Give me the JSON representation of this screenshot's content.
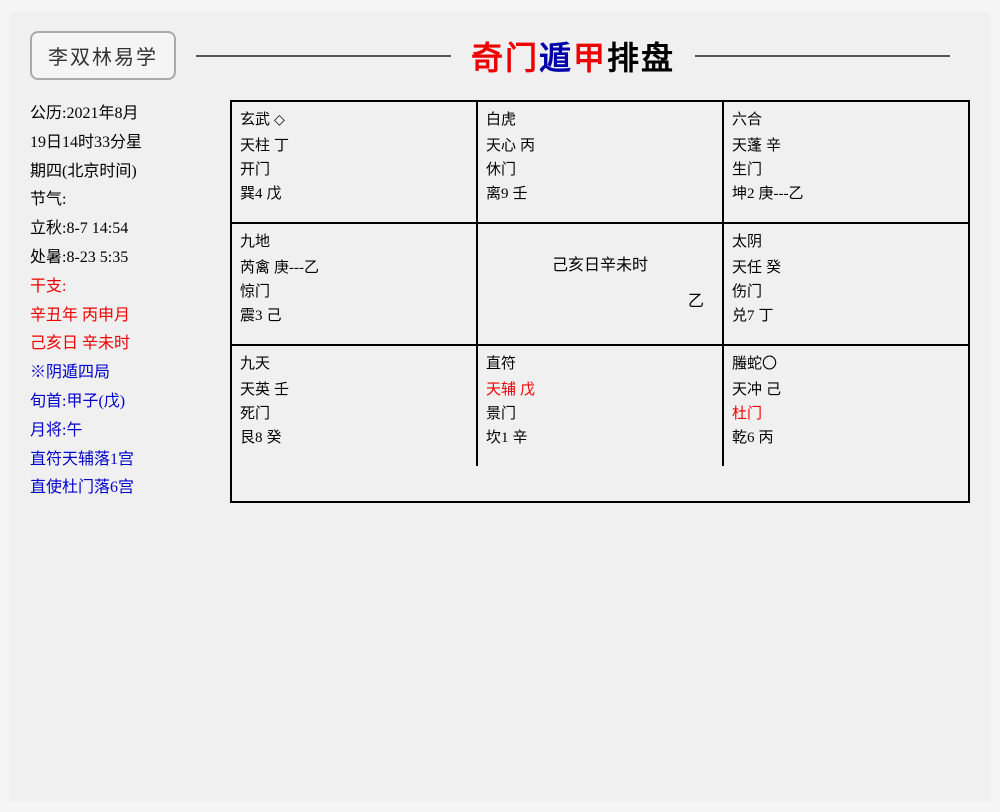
{
  "header": {
    "logo": "李双林易学",
    "title_part1": "奇门",
    "title_part2": "遁甲",
    "title_part3": "排盘"
  },
  "left_panel": {
    "line1": "公历:2021年8月",
    "line2": "19日14时33分星",
    "line3": "期四(北京时间)",
    "line4": "节气:",
    "line5": "立秋:8-7  14:54",
    "line6": "处暑:8-23  5:35",
    "line7": "干支:",
    "line8": "辛丑年 丙申月",
    "line9": "己亥日 辛未时",
    "line10": "※阴遁四局",
    "line11": "旬首:甲子(戊)",
    "line12": "月将:午",
    "line13": "直符天辅落1宫",
    "line14": "直使杜门落6宫"
  },
  "grid": {
    "row1": [
      {
        "shen": "玄武",
        "extra": "◇",
        "star": "天柱",
        "star_stem": "丁",
        "door": "开门",
        "palace": "巽4",
        "palace_stem": "戊"
      },
      {
        "shen": "白虎",
        "extra": "",
        "star": "天心",
        "star_stem": "丙",
        "door": "休门",
        "palace": "离9",
        "palace_stem": "壬"
      },
      {
        "shen": "六合",
        "extra": "",
        "star": "天蓬",
        "star_stem": "辛",
        "door": "生门",
        "palace": "坤2",
        "palace_stem": "庚---乙"
      }
    ],
    "row2": [
      {
        "shen": "九地",
        "extra": "",
        "star": "芮禽",
        "star_stem": "庚---乙",
        "door": "惊门",
        "palace": "震3",
        "palace_stem": "己"
      },
      {
        "center": true,
        "text1": "己亥日辛未时",
        "text2": "",
        "extra_stem": "乙"
      },
      {
        "shen": "太阴",
        "extra": "",
        "star": "天任",
        "star_stem": "癸",
        "door": "伤门",
        "palace": "兑7",
        "palace_stem": "丁"
      }
    ],
    "row3": [
      {
        "shen": "九天",
        "extra": "",
        "star": "天英",
        "star_stem": "壬",
        "door": "死门",
        "palace": "艮8",
        "palace_stem": "癸"
      },
      {
        "shen": "直符",
        "extra": "",
        "star": "天辅",
        "star_stem": "戊",
        "star_red": true,
        "door": "景门",
        "palace": "坎1",
        "palace_stem": "辛"
      },
      {
        "shen": "螣蛇〇",
        "extra": "",
        "star": "天冲",
        "star_stem": "己",
        "door": "杜门",
        "door_red": true,
        "palace": "乾6",
        "palace_stem": "丙"
      }
    ]
  }
}
